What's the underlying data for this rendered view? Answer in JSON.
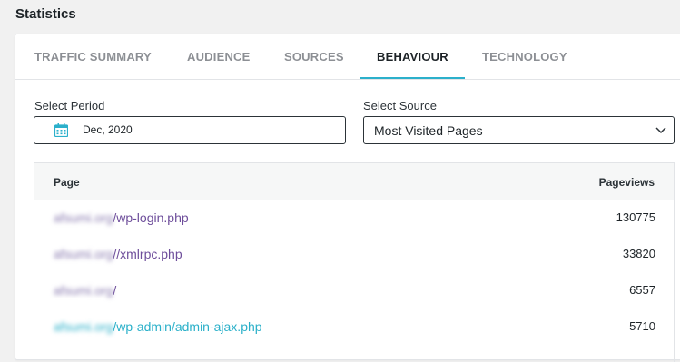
{
  "page": {
    "title": "Statistics"
  },
  "tabs": [
    {
      "label": "TRAFFIC SUMMARY",
      "active": false
    },
    {
      "label": "AUDIENCE",
      "active": false
    },
    {
      "label": "SOURCES",
      "active": false
    },
    {
      "label": "BEHAVIOUR",
      "active": true
    },
    {
      "label": "TECHNOLOGY",
      "active": false
    }
  ],
  "filters": {
    "period_label": "Select Period",
    "period_value": "Dec, 2020",
    "source_label": "Select Source",
    "source_value": "Most Visited Pages"
  },
  "table": {
    "headers": {
      "page": "Page",
      "pageviews": "Pageviews"
    },
    "rows": [
      {
        "domain": "afsumi.org",
        "path": "/wp-login.php",
        "pageviews": "130775"
      },
      {
        "domain": "afsumi.org",
        "path": "//xmlrpc.php",
        "pageviews": "33820"
      },
      {
        "domain": "afsumi.org",
        "path": "/",
        "pageviews": "6557"
      },
      {
        "domain": "afsumi.org",
        "path": "/wp-admin/admin-ajax.php",
        "pageviews": "5710"
      }
    ]
  },
  "colors": {
    "accent": "#2bb0cb",
    "link": "#6e4e9b",
    "link_hover": "#2ab0c9"
  },
  "icons": {
    "period": "calendar-icon",
    "source": "chevron-down-icon"
  }
}
